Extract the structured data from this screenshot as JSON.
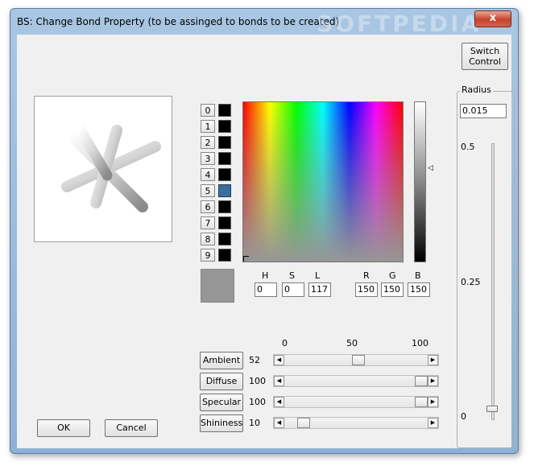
{
  "window": {
    "title": "BS: Change Bond Property (to be assinged to bonds to be created)",
    "watermark": "SOFTPEDIA",
    "close_glyph": "x"
  },
  "switch_control_label": "Switch Control",
  "palette": {
    "indices": [
      "0",
      "1",
      "2",
      "3",
      "4",
      "5",
      "6",
      "7",
      "8",
      "9"
    ],
    "colors": [
      "#000000",
      "#000000",
      "#000000",
      "#000000",
      "#000000",
      "#3b6e9c",
      "#000000",
      "#000000",
      "#000000",
      "#000000"
    ],
    "selected_index": 5
  },
  "current_color": "#969696",
  "hsl": {
    "labels": [
      "H",
      "S",
      "L"
    ],
    "values": [
      "0",
      "0",
      "117"
    ]
  },
  "rgb": {
    "labels": [
      "R",
      "G",
      "B"
    ],
    "values": [
      "150",
      "150",
      "150"
    ]
  },
  "scale_labels": [
    "0",
    "50",
    "100"
  ],
  "lighting": [
    {
      "label": "Ambient",
      "value": "52",
      "level": 0.52
    },
    {
      "label": "Diffuse",
      "value": "100",
      "level": 1.0
    },
    {
      "label": "Specular",
      "value": "100",
      "level": 1.0
    },
    {
      "label": "Shininess",
      "value": "10",
      "level": 0.1
    }
  ],
  "radius": {
    "group_label": "Radius",
    "value": "0.015",
    "scale": [
      "0.5",
      "0.25",
      "0"
    ],
    "level": 0.015
  },
  "ok_label": "OK",
  "cancel_label": "Cancel",
  "arrows": {
    "left": "◀",
    "right": "▶"
  }
}
